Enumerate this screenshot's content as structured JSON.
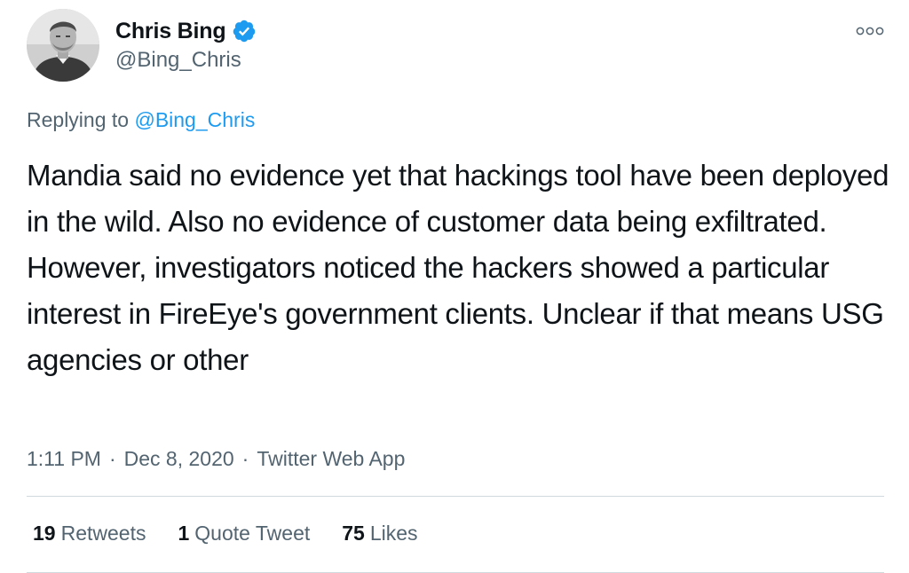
{
  "author": {
    "display_name": "Chris Bing",
    "handle": "@Bing_Chris",
    "verified": true
  },
  "icons": {
    "verified": "verified-badge-icon",
    "more": "more-options-icon"
  },
  "reply": {
    "prefix": "Replying to ",
    "target": "@Bing_Chris"
  },
  "tweet": {
    "text": "Mandia said no evidence yet that hackings tool have been deployed in the wild. Also no evidence of customer data being exfiltrated. However, investigators noticed the hackers showed a particular interest in FireEye's government clients. Unclear if that means USG agencies or other"
  },
  "meta": {
    "time": "1:11 PM",
    "separator": "·",
    "date": "Dec 8, 2020",
    "source": "Twitter Web App"
  },
  "stats": {
    "retweets_count": "19",
    "retweets_label": "Retweets",
    "quotes_count": "1",
    "quotes_label": "Quote Tweet",
    "likes_count": "75",
    "likes_label": "Likes"
  },
  "colors": {
    "text": "#0f1419",
    "secondary": "#536471",
    "accent": "#1d9bf0",
    "divider": "#cfd9de"
  }
}
